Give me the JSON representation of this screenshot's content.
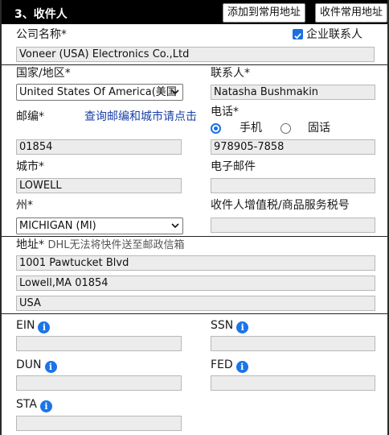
{
  "header": {
    "title": "3、收件人",
    "btn_add_common": "添加到常用地址",
    "btn_common": "收件常用地址"
  },
  "company": {
    "label": "公司名称*",
    "value": "Voneer (USA) Electronics Co.,Ltd",
    "enterprise_checkbox_label": "企业联系人",
    "enterprise_checked": true
  },
  "country": {
    "label": "国家/地区*",
    "selected": "United States Of America(美国"
  },
  "contact": {
    "label": "联系人*",
    "value": "Natasha Bushmakin"
  },
  "postcode": {
    "label": "邮编*",
    "lookup_link": "查询邮编和城市请点击",
    "value": "01854"
  },
  "phone": {
    "label": "电话*",
    "type_mobile": "手机",
    "type_landline": "固话",
    "selected_type": "手机",
    "value": "978905-7858"
  },
  "city": {
    "label": "城市*",
    "value": "LOWELL"
  },
  "email": {
    "label": "电子邮件",
    "value": ""
  },
  "state": {
    "label": "州*",
    "selected": "MICHIGAN (MI)"
  },
  "vat": {
    "label": "收件人增值税/商品服务税号",
    "value": ""
  },
  "address": {
    "label": "地址*",
    "note": "DHL无法将快件送至邮政信箱",
    "line1": "1001 Pawtucket Blvd",
    "line2": "Lowell,MA 01854",
    "line3": "USA"
  },
  "tax_ids": {
    "ein_label": "EIN",
    "ssn_label": "SSN",
    "dun_label": "DUN",
    "fed_label": "FED",
    "sta_label": "STA",
    "info_glyph": "i"
  },
  "colors": {
    "header_bg": "#000000",
    "accent": "#1c6fe0",
    "link": "#1a3fa8",
    "input_bg": "#ececec"
  },
  "icons": [
    "info-icon",
    "chevron-down-icon",
    "checkbox-checked-icon",
    "radio-icon"
  ]
}
